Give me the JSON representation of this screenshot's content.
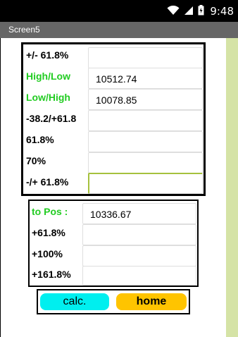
{
  "status_bar": {
    "time": "9:48",
    "icons": [
      "wifi-icon",
      "signal-icon",
      "battery-icon"
    ]
  },
  "title_bar": {
    "title": "Screen5"
  },
  "panel1": {
    "rows": [
      {
        "label": "+/- 61.8%",
        "value": "",
        "label_color": "black"
      },
      {
        "label": "High/Low",
        "value": "10512.74",
        "label_color": "green"
      },
      {
        "label": "Low/High",
        "value": "10078.85",
        "label_color": "green"
      },
      {
        "label": "-38.2/+61.8",
        "value": "",
        "label_color": "black"
      },
      {
        "label": "61.8%",
        "value": "",
        "label_color": "black"
      },
      {
        "label": "70%",
        "value": "",
        "label_color": "black"
      },
      {
        "label": "-/+ 61.8%",
        "value": "",
        "label_color": "black"
      }
    ]
  },
  "panel2": {
    "rows": [
      {
        "label": "to Pos :",
        "value": "10336.67",
        "label_color": "green"
      },
      {
        "label": "+61.8%",
        "value": "",
        "label_color": "black"
      },
      {
        "label": "+100%",
        "value": "",
        "label_color": "black"
      },
      {
        "label": "+161.8%",
        "value": "",
        "label_color": "black"
      }
    ]
  },
  "buttons": {
    "calc_label": "calc.",
    "home_label": "home"
  },
  "colors": {
    "accent_green": "#22cc22",
    "calc_button": "#00efef",
    "home_button": "#ffc400",
    "side_strip": "#d5e3a6",
    "title_bar": "#666666"
  }
}
